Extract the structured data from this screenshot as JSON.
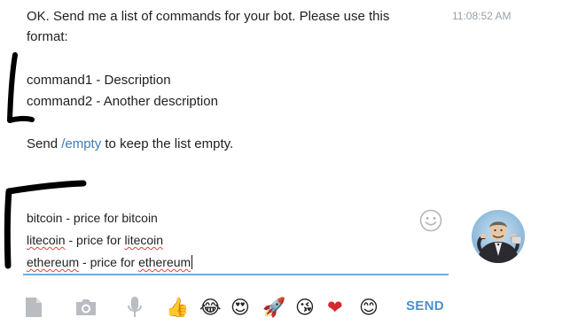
{
  "message": {
    "time": "11:08:52 AM",
    "line1": "OK. Send me a list of commands for your bot. Please use this",
    "line2": "format:",
    "example1": "command1 - Description",
    "example2": "command2 - Another description",
    "send_prefix": "Send ",
    "send_command": "/empty",
    "send_suffix": " to keep the list empty."
  },
  "composer": {
    "lines": [
      {
        "term": "bitcoin",
        "sep": " - price for ",
        "term2": "bitcoin"
      },
      {
        "term": "litecoin",
        "sep": " - price for ",
        "term2": "litecoin"
      },
      {
        "term": "ethereum",
        "sep": " - price for ",
        "term2": "ethereum"
      }
    ]
  },
  "toolbar": {
    "icons": [
      "file-icon",
      "camera-icon",
      "microphone-icon"
    ],
    "stickers": [
      "👍",
      "😂",
      "😍",
      "🚀",
      "😘",
      "❤",
      "😊"
    ],
    "send_label": "SEND"
  },
  "colors": {
    "accent": "#4a90d0",
    "link": "#3a7cb8",
    "input_underline": "#6aaee6",
    "icon_gray": "#b9bcc0"
  }
}
